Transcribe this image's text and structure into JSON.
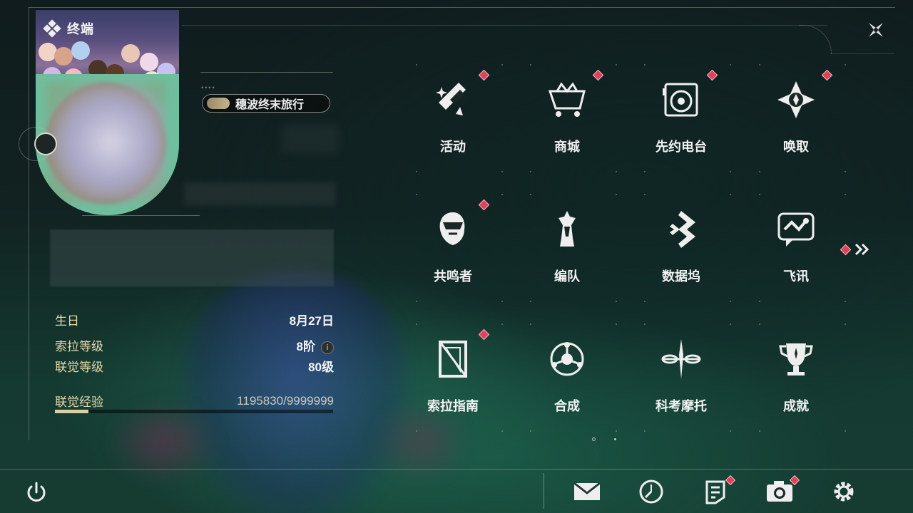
{
  "header": {
    "title": "终端"
  },
  "profile": {
    "title_tag": "穗波终末旅行",
    "stats": [
      {
        "label": "生日",
        "value": "8月27日"
      },
      {
        "label": "索拉等级",
        "value": "8阶"
      },
      {
        "label": "联觉等级",
        "value": "80级"
      }
    ],
    "experience": {
      "label": "联觉经验",
      "value": "1195830/9999999",
      "progress": 0.12
    }
  },
  "menu": {
    "items": [
      {
        "label": "活动",
        "icon": "sparkle-icon",
        "badge": true
      },
      {
        "label": "商城",
        "icon": "shop-cart-icon",
        "badge": true
      },
      {
        "label": "先约电台",
        "icon": "radio-icon",
        "badge": true
      },
      {
        "label": "唤取",
        "icon": "convene-icon",
        "badge": true
      },
      {
        "label": "共鸣者",
        "icon": "resonator-icon",
        "badge": true
      },
      {
        "label": "编队",
        "icon": "chess-icon",
        "badge": false
      },
      {
        "label": "数据坞",
        "icon": "data-bank-icon",
        "badge": false
      },
      {
        "label": "飞讯",
        "icon": "chat-icon",
        "badge": false
      },
      {
        "label": "索拉指南",
        "icon": "guidebook-icon",
        "badge": true
      },
      {
        "label": "合成",
        "icon": "synthesis-icon",
        "badge": false
      },
      {
        "label": "科考摩托",
        "icon": "motorcycle-icon",
        "badge": false
      },
      {
        "label": "成就",
        "icon": "trophy-icon",
        "badge": false
      }
    ],
    "page_current": 1,
    "page_total": 2
  },
  "bottom_bar": {
    "buttons": [
      {
        "icon": "mail-icon",
        "badge": false
      },
      {
        "icon": "clock-icon",
        "badge": false
      },
      {
        "icon": "notice-icon",
        "badge": true
      },
      {
        "icon": "camera-icon",
        "badge": true
      },
      {
        "icon": "settings-gear-icon",
        "badge": false
      }
    ]
  },
  "colors": {
    "accent_gold": "#e5d9a8",
    "badge_red": "#d8455b",
    "avatar_bg": "#6fbf9e"
  }
}
